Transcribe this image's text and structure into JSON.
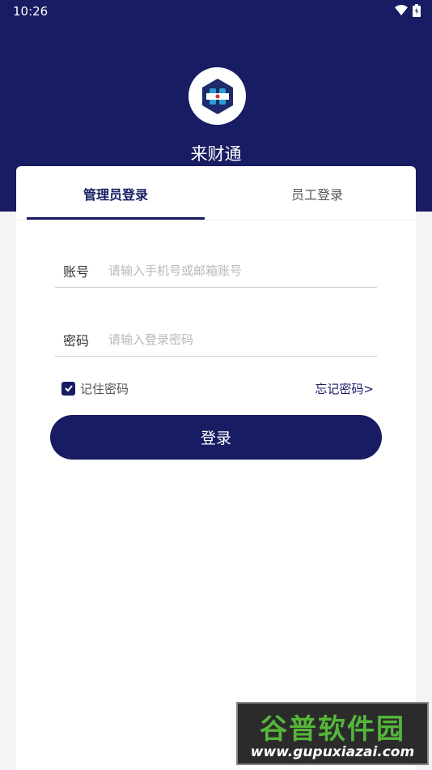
{
  "status_bar": {
    "time": "10:26",
    "icons": [
      "wifi-icon",
      "battery-icon"
    ]
  },
  "header": {
    "app_name": "来财通",
    "logo": "app-logo-icon",
    "bg_color": "#181c62"
  },
  "tabs": [
    {
      "label": "管理员登录",
      "active": true
    },
    {
      "label": "员工登录",
      "active": false
    }
  ],
  "form": {
    "account": {
      "label": "账号",
      "value": "",
      "placeholder": "请输入手机号或邮箱账号"
    },
    "password": {
      "label": "密码",
      "value": "",
      "placeholder": "请输入登录密码"
    },
    "remember": {
      "label": "记住密码",
      "checked": true
    },
    "forgot_label": "忘记密码>",
    "submit_label": "登录"
  },
  "watermark": {
    "title": "谷普软件园",
    "url": "www.gupuxiazai.com"
  },
  "colors": {
    "primary": "#181c62",
    "background": "#f4f4f6",
    "placeholder": "#b8b8b8"
  }
}
